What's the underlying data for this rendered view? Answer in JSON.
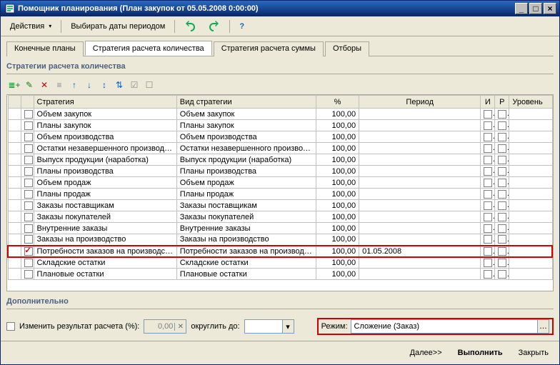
{
  "window": {
    "title": "Помощник планирования (План закупок от 05.05.2008 0:00:00)"
  },
  "toolbar": {
    "actions": "Действия",
    "choose_dates": "Выбирать даты периодом"
  },
  "tabs": {
    "final_plans": "Конечные планы",
    "qty_strategy": "Стратегия расчета количества",
    "sum_strategy": "Стратегия расчета суммы",
    "filters": "Отборы"
  },
  "group_title": "Стратегии расчета количества",
  "columns": {
    "strategy": "Стратегия",
    "type": "Вид стратегии",
    "pct": "%",
    "period": "Период",
    "i": "И",
    "r": "Р",
    "level": "Уровень"
  },
  "rows": [
    {
      "strategy": "Объем закупок",
      "type": "Объем закупок",
      "pct": "100,00",
      "period": "",
      "checked": false,
      "hl": false
    },
    {
      "strategy": "Планы закупок",
      "type": "Планы закупок",
      "pct": "100,00",
      "period": "",
      "checked": false,
      "hl": false
    },
    {
      "strategy": "Объем производства",
      "type": "Объем производства",
      "pct": "100,00",
      "period": "",
      "checked": false,
      "hl": false
    },
    {
      "strategy": "Остатки незавершенного производства",
      "type": "Остатки незавершенного производ...",
      "pct": "100,00",
      "period": "",
      "checked": false,
      "hl": false
    },
    {
      "strategy": "Выпуск продукции (наработка)",
      "type": "Выпуск продукции (наработка)",
      "pct": "100,00",
      "period": "",
      "checked": false,
      "hl": false
    },
    {
      "strategy": "Планы производства",
      "type": "Планы производства",
      "pct": "100,00",
      "period": "",
      "checked": false,
      "hl": false
    },
    {
      "strategy": "Объем продаж",
      "type": "Объем продаж",
      "pct": "100,00",
      "period": "",
      "checked": false,
      "hl": false
    },
    {
      "strategy": "Планы продаж",
      "type": "Планы продаж",
      "pct": "100,00",
      "period": "",
      "checked": false,
      "hl": false
    },
    {
      "strategy": "Заказы поставщикам",
      "type": "Заказы поставщикам",
      "pct": "100,00",
      "period": "",
      "checked": false,
      "hl": false
    },
    {
      "strategy": "Заказы покупателей",
      "type": "Заказы покупателей",
      "pct": "100,00",
      "period": "",
      "checked": false,
      "hl": false
    },
    {
      "strategy": "Внутренние заказы",
      "type": "Внутренние заказы",
      "pct": "100,00",
      "period": "",
      "checked": false,
      "hl": false
    },
    {
      "strategy": "Заказы на производство",
      "type": "Заказы на производство",
      "pct": "100,00",
      "period": "",
      "checked": false,
      "hl": false
    },
    {
      "strategy": "Потребности заказов на производство",
      "type": "Потребности заказов на производс...",
      "pct": "100,00",
      "period": "01.05.2008",
      "checked": true,
      "hl": true
    },
    {
      "strategy": "Складские остатки",
      "type": "Складские остатки",
      "pct": "100,00",
      "period": "",
      "checked": false,
      "hl": false
    },
    {
      "strategy": "Плановые остатки",
      "type": "Плановые остатки",
      "pct": "100,00",
      "period": "",
      "checked": false,
      "hl": false
    }
  ],
  "extra": {
    "group_title": "Дополнительно",
    "change_result": "Изменить результат расчета (%):",
    "change_value": "0,00",
    "round_to": "округлить до:",
    "mode_label": "Режим:",
    "mode_value": "Сложение (Заказ)"
  },
  "footer": {
    "next": "Далее>>",
    "run": "Выполнить",
    "close": "Закрыть"
  }
}
